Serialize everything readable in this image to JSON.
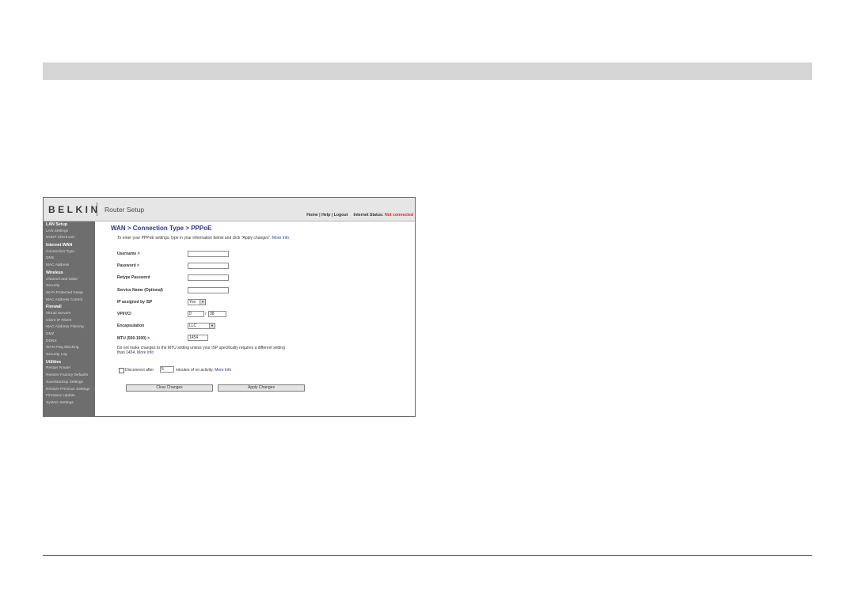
{
  "brand": {
    "logo": "BELKIN",
    "app_title": "Router Setup"
  },
  "header": {
    "links": [
      "Home",
      "Help",
      "Logout"
    ],
    "status_label": "Internet Status:",
    "status_value": "Not connected",
    "status_color": "#e2231a"
  },
  "sidebar": [
    {
      "label": "LAN Setup",
      "type": "heading"
    },
    {
      "label": "LAN Settings",
      "type": "item"
    },
    {
      "label": "DHCP Client List",
      "type": "item"
    },
    {
      "label": "Internet WAN",
      "type": "heading"
    },
    {
      "label": "Connection Type",
      "type": "item"
    },
    {
      "label": "DNS",
      "type": "item"
    },
    {
      "label": "MAC Address",
      "type": "item"
    },
    {
      "label": "Wireless",
      "type": "heading"
    },
    {
      "label": "Channel and SSID",
      "type": "item"
    },
    {
      "label": "Security",
      "type": "item"
    },
    {
      "label": "Wi-Fi Protected Setup",
      "type": "item"
    },
    {
      "label": "MAC Address Control",
      "type": "item"
    },
    {
      "label": "Firewall",
      "type": "heading"
    },
    {
      "label": "Virtual Servers",
      "type": "item"
    },
    {
      "label": "Client IP Filters",
      "type": "item"
    },
    {
      "label": "MAC Address Filtering",
      "type": "item"
    },
    {
      "label": "DMZ",
      "type": "item"
    },
    {
      "label": "DDNS",
      "type": "item"
    },
    {
      "label": "WAN Ping Blocking",
      "type": "item"
    },
    {
      "label": "Security Log",
      "type": "item"
    },
    {
      "label": "Utilities",
      "type": "heading"
    },
    {
      "label": "Restart Router",
      "type": "item"
    },
    {
      "label": "Restore Factory Defaults",
      "type": "item"
    },
    {
      "label": "Save/Backup Settings",
      "type": "item"
    },
    {
      "label": "Restore Previous Settings",
      "type": "item"
    },
    {
      "label": "Firmware Update",
      "type": "item"
    },
    {
      "label": "System Settings",
      "type": "item"
    }
  ],
  "main": {
    "title": "WAN > Connection Type > PPPoE",
    "intro": "To enter your PPPoE settings, type in your information below and click \"Apply changes\".",
    "more_info": "More Info",
    "fields": {
      "username_label": "Username >",
      "username_value": "",
      "password_label": "Password >",
      "password_value": "",
      "retype_label": "Retype Password",
      "retype_value": "",
      "service_label": "Service Name (Optional)",
      "service_value": "",
      "ip_label": "IP assigned by ISP",
      "ip_value": "Yes",
      "vpi_label": "VPI/VCI",
      "vpi_value": "0",
      "vci_value": "38",
      "encap_label": "Encapsulation",
      "encap_value": "LLC",
      "mtu_label": "MTU (500-1500) >",
      "mtu_value": "1454"
    },
    "note_line1": "Do not make changes to the MTU setting unless your ISP specifically requires a different setting",
    "note_line2": "than 1454.",
    "note_more": "More Info",
    "disconnect_label": "Disconnect after",
    "disconnect_value": "5",
    "disconnect_after": "minutes of no activity.",
    "disconnect_more": "More Info",
    "clear_button": "Clear Changes",
    "apply_button": "Apply Changes"
  }
}
